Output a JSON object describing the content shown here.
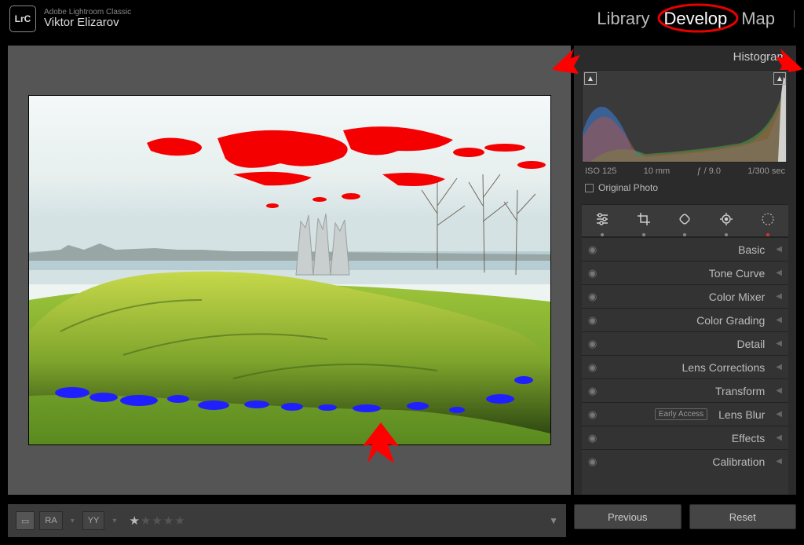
{
  "header": {
    "app_line": "Adobe Lightroom Classic",
    "user_name": "Viktor Elizarov",
    "logo_text": "LrC",
    "modules": {
      "library": "Library",
      "develop": "Develop",
      "map": "Map",
      "active": "Develop"
    }
  },
  "histogram": {
    "title": "Histogram",
    "iso": "ISO 125",
    "focal": "10 mm",
    "aperture": "ƒ / 9.0",
    "shutter": "1/300 sec",
    "original_label": "Original Photo",
    "clip_glyph": "▲"
  },
  "toolstrip": {
    "sliders": "sliders-icon",
    "crop": "crop-icon",
    "heal": "heal-icon",
    "redeye": "redeye-icon",
    "mask": "mask-icon"
  },
  "panels": {
    "items": [
      {
        "label": "Basic",
        "badge": null
      },
      {
        "label": "Tone Curve",
        "badge": null
      },
      {
        "label": "Color Mixer",
        "badge": null
      },
      {
        "label": "Color Grading",
        "badge": null
      },
      {
        "label": "Detail",
        "badge": null
      },
      {
        "label": "Lens Corrections",
        "badge": null
      },
      {
        "label": "Transform",
        "badge": null
      },
      {
        "label": "Lens Blur",
        "badge": "Early Access"
      },
      {
        "label": "Effects",
        "badge": null
      },
      {
        "label": "Calibration",
        "badge": null
      }
    ]
  },
  "toolbar": {
    "rating_on": "★",
    "rating_off": "★★★★",
    "view_a": "▭",
    "view_b": "RA",
    "view_c": "YY"
  },
  "footer": {
    "previous": "Previous",
    "reset": "Reset"
  }
}
